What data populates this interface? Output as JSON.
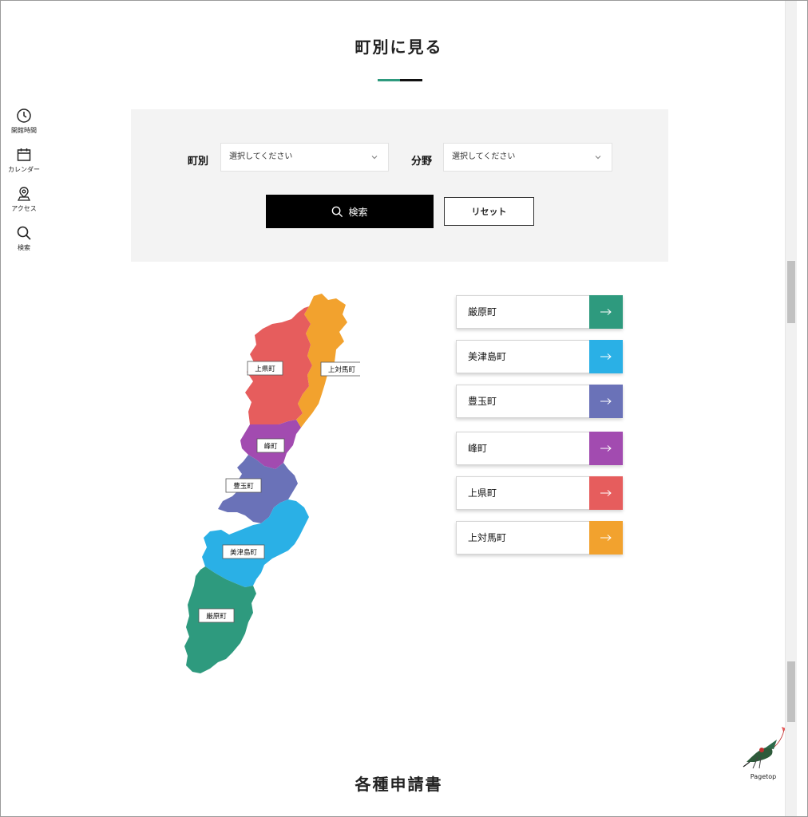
{
  "sidebar": {
    "items": [
      {
        "label": "開館時間",
        "icon": "clock-icon"
      },
      {
        "label": "カレンダー",
        "icon": "calendar-icon"
      },
      {
        "label": "アクセス",
        "icon": "location-pin-icon"
      },
      {
        "label": "検索",
        "icon": "search-icon"
      }
    ]
  },
  "section": {
    "title": "町別に見る",
    "next_title": "各種申請書"
  },
  "search_panel": {
    "town_label": "町別",
    "town_placeholder": "選択してください",
    "field_label": "分野",
    "field_placeholder": "選択してください",
    "search_button": "検索",
    "reset_button": "リセット"
  },
  "map": {
    "labels": [
      "上県町",
      "上対馬町",
      "峰町",
      "豊玉町",
      "美津島町",
      "厳原町"
    ]
  },
  "towns": [
    {
      "name": "厳原町",
      "color": "#2e9a7e"
    },
    {
      "name": "美津島町",
      "color": "#2ab0e6"
    },
    {
      "name": "豊玉町",
      "color": "#6a72b8"
    },
    {
      "name": "峰町",
      "color": "#a24bb0"
    },
    {
      "name": "上県町",
      "color": "#e65d5d"
    },
    {
      "name": "上対馬町",
      "color": "#f2a22e"
    }
  ],
  "pagetop": {
    "label": "Pagetop",
    "icon": "bird-kite-icon"
  }
}
